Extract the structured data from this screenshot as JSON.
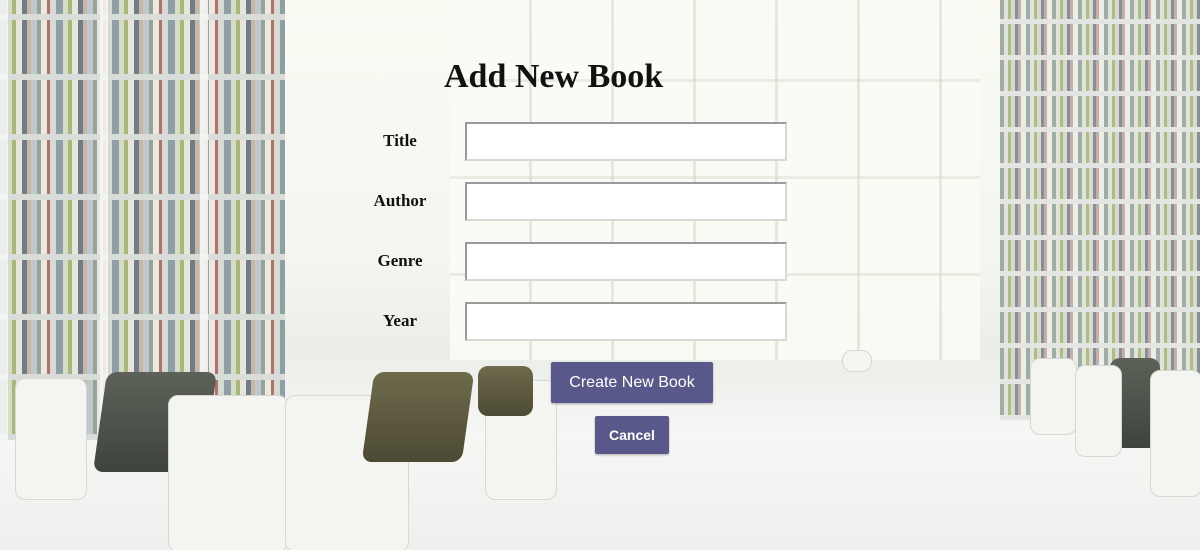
{
  "page": {
    "title": "Add New Book"
  },
  "form": {
    "fields": [
      {
        "label": "Title",
        "value": "",
        "placeholder": ""
      },
      {
        "label": "Author",
        "value": "",
        "placeholder": ""
      },
      {
        "label": "Genre",
        "value": "",
        "placeholder": ""
      },
      {
        "label": "Year",
        "value": "",
        "placeholder": ""
      }
    ],
    "create_label": "Create New Book",
    "cancel_label": "Cancel"
  },
  "colors": {
    "button_bg": "#58598a",
    "button_text": "#ffffff"
  }
}
